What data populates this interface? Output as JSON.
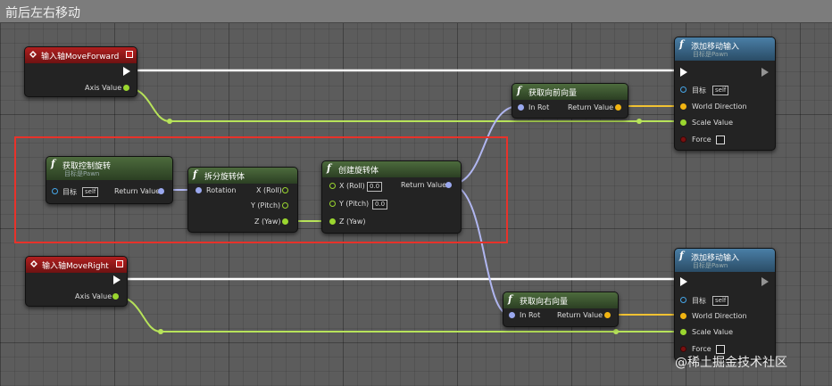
{
  "comment": {
    "title": "前后左右移动"
  },
  "input_forward": {
    "title": "输入轴MoveForward",
    "axis_label": "Axis Value"
  },
  "input_right": {
    "title": "输入轴MoveRight",
    "axis_label": "Axis Value"
  },
  "get_control_rotation": {
    "title": "获取控制旋转",
    "subtitle": "目标是Pawn",
    "target_label": "目标",
    "target_value": "self",
    "return_label": "Return Value"
  },
  "break_rotator": {
    "title": "拆分旋转体",
    "rotation_label": "Rotation",
    "x_label": "X (Roll)",
    "y_label": "Y (Pitch)",
    "z_label": "Z (Yaw)"
  },
  "make_rotator": {
    "title": "创建旋转体",
    "x_label": "X (Roll)",
    "x_value": "0.0",
    "y_label": "Y (Pitch)",
    "y_value": "0.0",
    "z_label": "Z (Yaw)",
    "return_label": "Return Value"
  },
  "get_forward_vector": {
    "title": "获取向前向量",
    "in_label": "In Rot",
    "return_label": "Return Value"
  },
  "get_right_vector": {
    "title": "获取向右向量",
    "in_label": "In Rot",
    "return_label": "Return Value"
  },
  "add_movement_1": {
    "title": "添加移动输入",
    "subtitle": "目标是Pawn",
    "target_label": "目标",
    "target_value": "self",
    "direction_label": "World Direction",
    "scale_label": "Scale Value",
    "force_label": "Force"
  },
  "add_movement_2": {
    "title": "添加移动输入",
    "subtitle": "目标是Pawn",
    "target_label": "目标",
    "target_value": "self",
    "direction_label": "World Direction",
    "scale_label": "Scale Value",
    "force_label": "Force"
  },
  "watermark": "@稀土掘金技术社区",
  "colors": {
    "exec": "#ffffff",
    "float": "#9ad62f",
    "rotator": "#9aa8ee",
    "vector": "#f1b411",
    "object": "#46a6e8",
    "selection": "#e8322a"
  }
}
